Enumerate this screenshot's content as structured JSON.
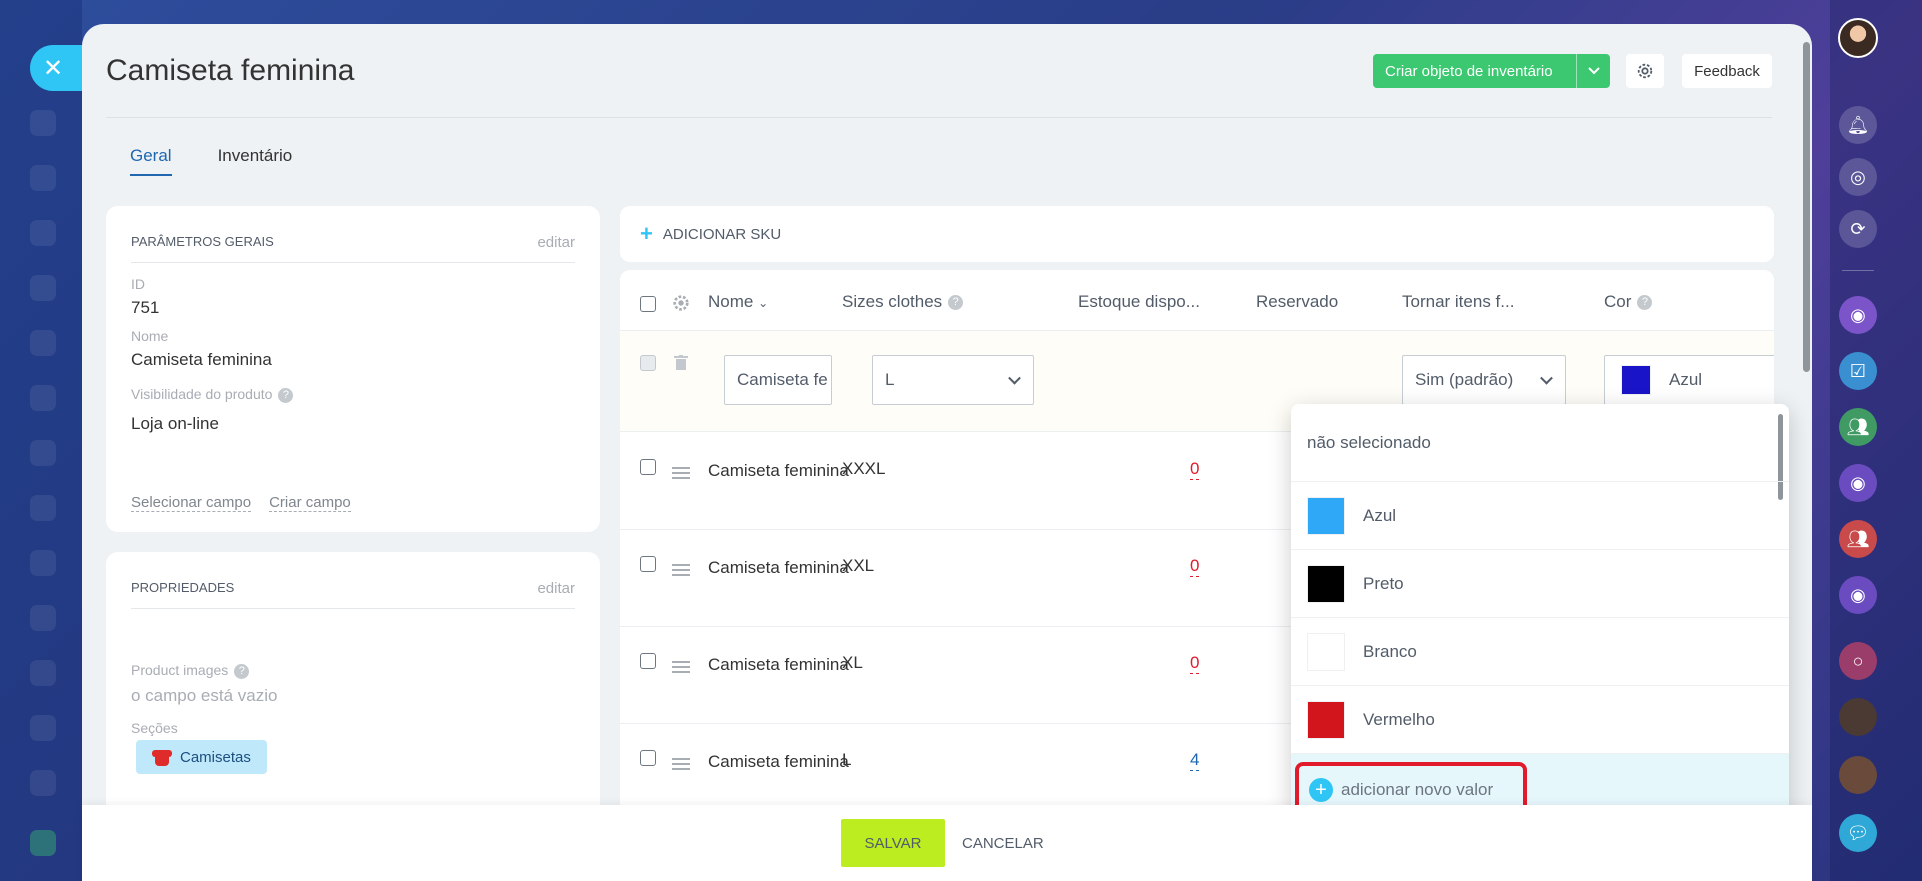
{
  "page_title": "Camiseta feminina",
  "header": {
    "create_button": "Criar objeto de inventário",
    "feedback": "Feedback"
  },
  "tabs": [
    "Geral",
    "Inventário"
  ],
  "general_params": {
    "title": "PARÂMETROS GERAIS",
    "edit": "editar",
    "id_label": "ID",
    "id_value": "751",
    "name_label": "Nome",
    "name_value": "Camiseta feminina",
    "visibility_label": "Visibilidade do produto",
    "visibility_value": "Loja on-line",
    "select_field": "Selecionar campo",
    "create_field": "Criar campo"
  },
  "properties": {
    "title": "PROPRIEDADES",
    "edit": "editar",
    "images_label": "Product images",
    "images_value": "o campo está vazio",
    "sections_label": "Seções",
    "section_chip": "Camisetas"
  },
  "sku": {
    "add_label": "ADICIONAR SKU",
    "columns": {
      "name": "Nome",
      "sizes": "Sizes clothes",
      "stock": "Estoque dispo...",
      "reserved": "Reservado",
      "make": "Tornar itens f...",
      "color": "Cor"
    },
    "edit_row": {
      "name_input": "Camiseta fe",
      "size_select": "L",
      "make_select": "Sim (padrão)",
      "color_select": "Azul",
      "color_hex": "#1a14c8"
    },
    "rows": [
      {
        "name": "Camiseta feminina",
        "size": "XXXL",
        "stock": "0",
        "stock_color": "#e11b2c"
      },
      {
        "name": "Camiseta feminina",
        "size": "XXL",
        "stock": "0",
        "stock_color": "#e11b2c"
      },
      {
        "name": "Camiseta feminina",
        "size": "XL",
        "stock": "0",
        "stock_color": "#e11b2c"
      },
      {
        "name": "Camiseta feminina",
        "size": "L",
        "stock": "4",
        "stock_color": "#2067b0"
      }
    ]
  },
  "color_dropdown": {
    "none": "não selecionado",
    "options": [
      {
        "label": "Azul",
        "hex": "#2fa8f8"
      },
      {
        "label": "Preto",
        "hex": "#000000"
      },
      {
        "label": "Branco",
        "hex": "#ffffff"
      },
      {
        "label": "Vermelho",
        "hex": "#d2141c"
      }
    ],
    "add_new": "adicionar novo valor"
  },
  "footer": {
    "save": "SALVAR",
    "cancel": "CANCELAR"
  }
}
